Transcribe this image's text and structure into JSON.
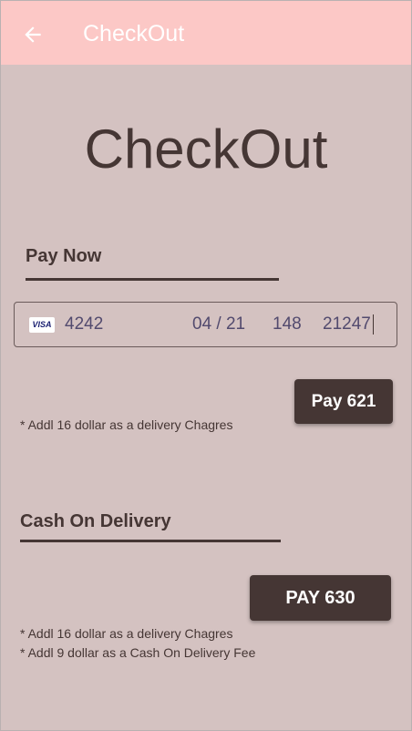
{
  "app_bar": {
    "title": "CheckOut",
    "back_icon": "arrow-left-icon"
  },
  "page_title": "CheckOut",
  "pay_now": {
    "heading": "Pay Now",
    "card": {
      "brand_icon": "visa-card-icon",
      "brand_text": "VISA",
      "number": "4242",
      "expiry": "04 / 21",
      "cvc": "148",
      "postal_code": "21247"
    },
    "pay_button": "Pay 621",
    "note": "* Addl 16 dollar as a delivery Chagres"
  },
  "cash_on_delivery": {
    "heading": "Cash On Delivery",
    "pay_button": "PAY 630",
    "notes": [
      "* Addl 16 dollar as a delivery Chagres",
      "* Addl 9 dollar as a Cash On Delivery Fee"
    ]
  },
  "colors": {
    "app_bar": "#fcc8c6",
    "background": "#d4c2c1",
    "primary_dark": "#453634",
    "card_text": "#524a6e"
  }
}
